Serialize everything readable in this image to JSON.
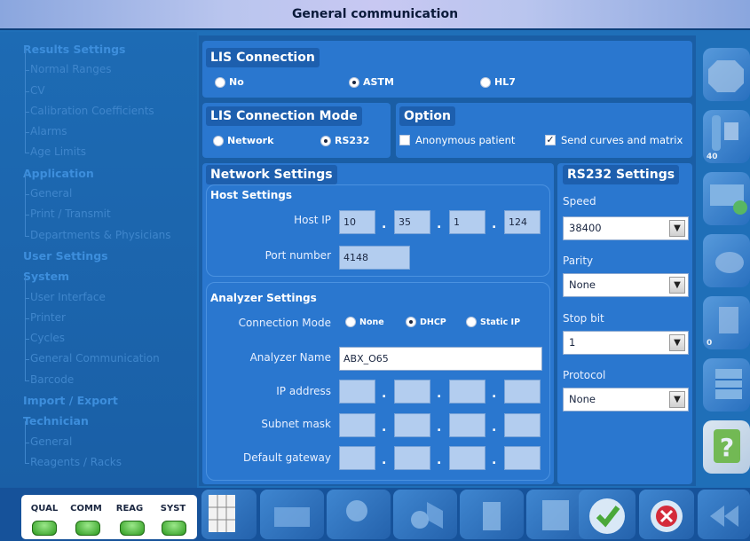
{
  "window": {
    "title": "General communication"
  },
  "sidebar": {
    "groups": [
      {
        "label": "Results Settings",
        "items": [
          "Normal Ranges",
          "CV",
          "Calibration Coefficients",
          "Alarms",
          "Age Limits"
        ]
      },
      {
        "label": "Application",
        "items": [
          "General",
          "Print / Transmit",
          "Departments & Physicians"
        ]
      },
      {
        "label": "User Settings",
        "items": []
      },
      {
        "label": "System",
        "items": [
          "User Interface",
          "Printer",
          "Cycles",
          "General Communication",
          "Barcode"
        ]
      },
      {
        "label": "Import / Export",
        "items": []
      },
      {
        "label": "Technician",
        "items": [
          "General",
          "Reagents / Racks"
        ]
      }
    ]
  },
  "lis_connection": {
    "title": "LIS Connection",
    "options": [
      "No",
      "ASTM",
      "HL7"
    ],
    "selected": "ASTM"
  },
  "lis_mode": {
    "title": "LIS Connection Mode",
    "options": [
      "Network",
      "RS232"
    ],
    "selected": "RS232"
  },
  "option": {
    "title": "Option",
    "anonymous_patient": {
      "label": "Anonymous patient",
      "checked": false
    },
    "send_curves": {
      "label": "Send curves and matrix",
      "checked": true,
      "mark": "✓"
    }
  },
  "network_settings": {
    "title": "Network Settings",
    "host_settings": {
      "title": "Host Settings",
      "host_ip_label": "Host IP",
      "host_ip": [
        "10",
        "35",
        "1",
        "124"
      ],
      "port_label": "Port number",
      "port": "4148"
    },
    "analyzer_settings": {
      "title": "Analyzer Settings",
      "connection_mode_label": "Connection Mode",
      "connection_options": [
        "None",
        "DHCP",
        "Static IP"
      ],
      "connection_selected": "DHCP",
      "analyzer_name_label": "Analyzer Name",
      "analyzer_name": "ABX_O65",
      "ip_label": "IP address",
      "subnet_label": "Subnet mask",
      "gateway_label": "Default gateway"
    }
  },
  "rs232": {
    "title": "RS232 Settings",
    "speed_label": "Speed",
    "speed": "38400",
    "parity_label": "Parity",
    "parity": "None",
    "stop_label": "Stop bit",
    "stop": "1",
    "protocol_label": "Protocol",
    "protocol": "None"
  },
  "right_toolbar": {
    "badge_tubes": "40",
    "badge_archive": "0",
    "help_glyph": "?"
  },
  "status": {
    "labels": [
      "QUAL",
      "COMM",
      "REAG",
      "SYST"
    ]
  },
  "colors": {
    "accent": "#2a77cf",
    "background": "#1f6fb8",
    "led_ok": "#2d9a1e"
  }
}
